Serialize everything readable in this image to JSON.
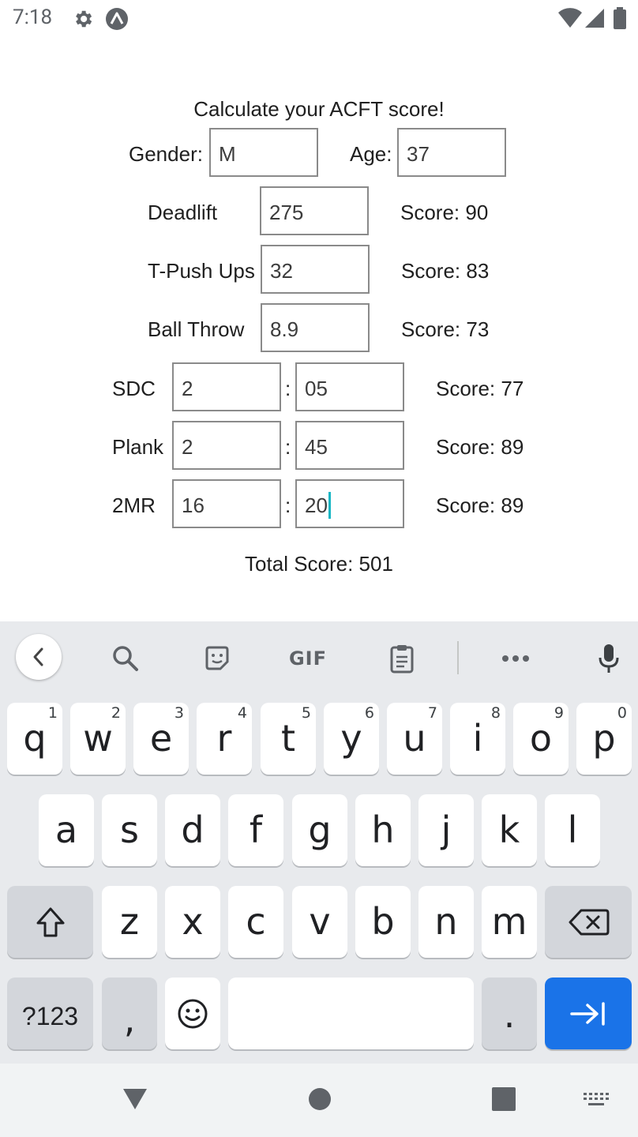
{
  "status_bar": {
    "time": "7:18"
  },
  "app": {
    "title": "Calculate your ACFT score!",
    "gender": {
      "label": "Gender:",
      "value": "M"
    },
    "age": {
      "label": "Age:",
      "value": "37"
    },
    "events": [
      {
        "label": "Deadlift",
        "value": "275",
        "score": "Score: 90"
      },
      {
        "label": "T-Push Ups",
        "value": "32",
        "score": "Score: 83"
      },
      {
        "label": "Ball Throw",
        "value": "8.9",
        "score": "Score: 73"
      }
    ],
    "timed_events": [
      {
        "label": "SDC",
        "minutes": "2",
        "seconds": "05",
        "score": "Score: 77"
      },
      {
        "label": "Plank",
        "minutes": "2",
        "seconds": "45",
        "score": "Score: 89"
      },
      {
        "label": "2MR",
        "minutes": "16",
        "seconds": "20",
        "score": "Score: 89"
      }
    ],
    "colon": ":",
    "total": "Total Score: 501"
  },
  "keyboard": {
    "toolbar": {
      "gif_label": "GIF"
    },
    "row1": [
      {
        "ch": "q",
        "num": "1"
      },
      {
        "ch": "w",
        "num": "2"
      },
      {
        "ch": "e",
        "num": "3"
      },
      {
        "ch": "r",
        "num": "4"
      },
      {
        "ch": "t",
        "num": "5"
      },
      {
        "ch": "y",
        "num": "6"
      },
      {
        "ch": "u",
        "num": "7"
      },
      {
        "ch": "i",
        "num": "8"
      },
      {
        "ch": "o",
        "num": "9"
      },
      {
        "ch": "p",
        "num": "0"
      }
    ],
    "row2": [
      "a",
      "s",
      "d",
      "f",
      "g",
      "h",
      "j",
      "k",
      "l"
    ],
    "row3": [
      "z",
      "x",
      "c",
      "v",
      "b",
      "n",
      "m"
    ],
    "symbols_label": "?123",
    "comma": ",",
    "period": ".",
    "accent_color": "#1a73e8"
  }
}
